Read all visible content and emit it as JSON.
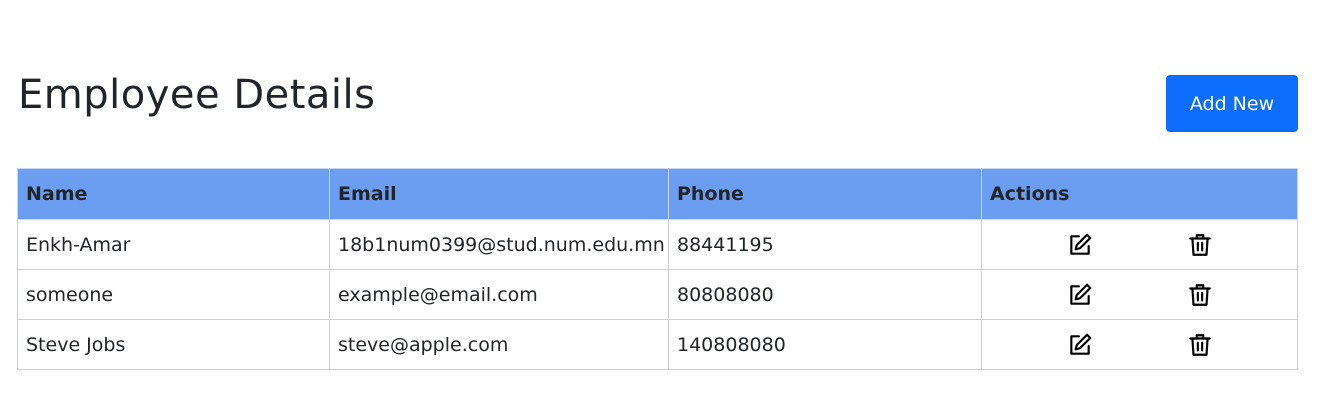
{
  "header": {
    "title": "Employee Details",
    "add_button_label": "Add New"
  },
  "table": {
    "columns": [
      "Name",
      "Email",
      "Phone",
      "Actions"
    ],
    "rows": [
      {
        "name": "Enkh-Amar",
        "email": "18b1num0399@stud.num.edu.mn",
        "phone": "88441195",
        "actions": [
          "edit-icon",
          "delete-icon"
        ]
      },
      {
        "name": "someone",
        "email": "example@email.com",
        "phone": "80808080",
        "actions": [
          "edit-icon",
          "delete-icon"
        ]
      },
      {
        "name": "Steve Jobs",
        "email": "steve@apple.com",
        "phone": "140808080",
        "actions": [
          "edit-icon",
          "delete-icon"
        ]
      }
    ]
  },
  "colors": {
    "primary_button": "#0d6efd",
    "table_header": "#6b9df0",
    "border": "#cfcfcf",
    "text": "#212529"
  }
}
